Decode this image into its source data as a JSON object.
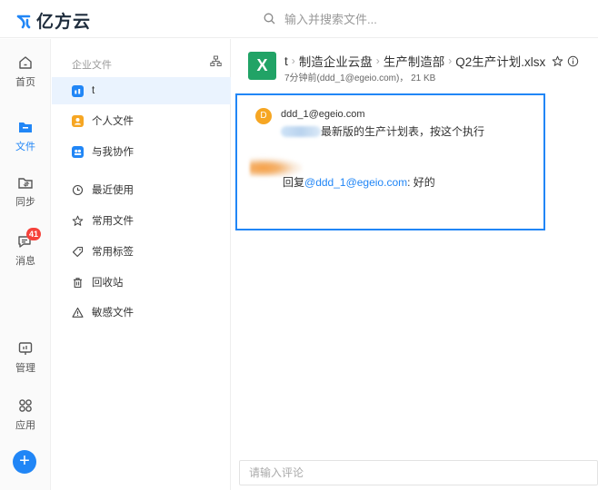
{
  "app": {
    "name": "亿方云"
  },
  "search": {
    "placeholder": "输入并搜索文件..."
  },
  "rail": [
    {
      "label": "首页",
      "icon": "home-icon"
    },
    {
      "label": "文件",
      "icon": "folder-icon",
      "active": true
    },
    {
      "label": "同步",
      "icon": "sync-icon"
    },
    {
      "label": "消息",
      "icon": "message-icon",
      "badge": "41"
    },
    {
      "label": "管理",
      "icon": "admin-icon"
    },
    {
      "label": "应用",
      "icon": "apps-icon"
    }
  ],
  "nav": {
    "header": "企业文件",
    "items": [
      {
        "label": "t",
        "icon": "enterprise-folder-icon"
      },
      {
        "label": "个人文件",
        "icon": "personal-folder-icon"
      },
      {
        "label": "与我协作",
        "icon": "collab-icon"
      },
      {
        "label": "最近使用",
        "icon": "clock-icon"
      },
      {
        "label": "常用文件",
        "icon": "star-icon"
      },
      {
        "label": "常用标签",
        "icon": "tag-icon"
      },
      {
        "label": "回收站",
        "icon": "trash-icon"
      },
      {
        "label": "敏感文件",
        "icon": "warning-icon"
      }
    ]
  },
  "file": {
    "icon_letter": "X",
    "breadcrumbs": [
      "t",
      "制造企业云盘",
      "生产制造部",
      "Q2生产计划.xlsx"
    ],
    "meta": "7分钟前(ddd_1@egeio.com)， 21 KB"
  },
  "comments": [
    {
      "avatar_letter": "D",
      "author": "ddd_1@egeio.com",
      "text": "最新版的生产计划表，按这个执行"
    },
    {
      "reply_prefix": "回复",
      "mention": "@ddd_1@egeio.com",
      "text": ": 好的"
    }
  ],
  "comment_input": {
    "placeholder": "请输入评论"
  },
  "colors": {
    "accent": "#2186f6",
    "excel_green": "#21a366",
    "badge_red": "#f5423b",
    "avatar_orange": "#f6a623"
  }
}
